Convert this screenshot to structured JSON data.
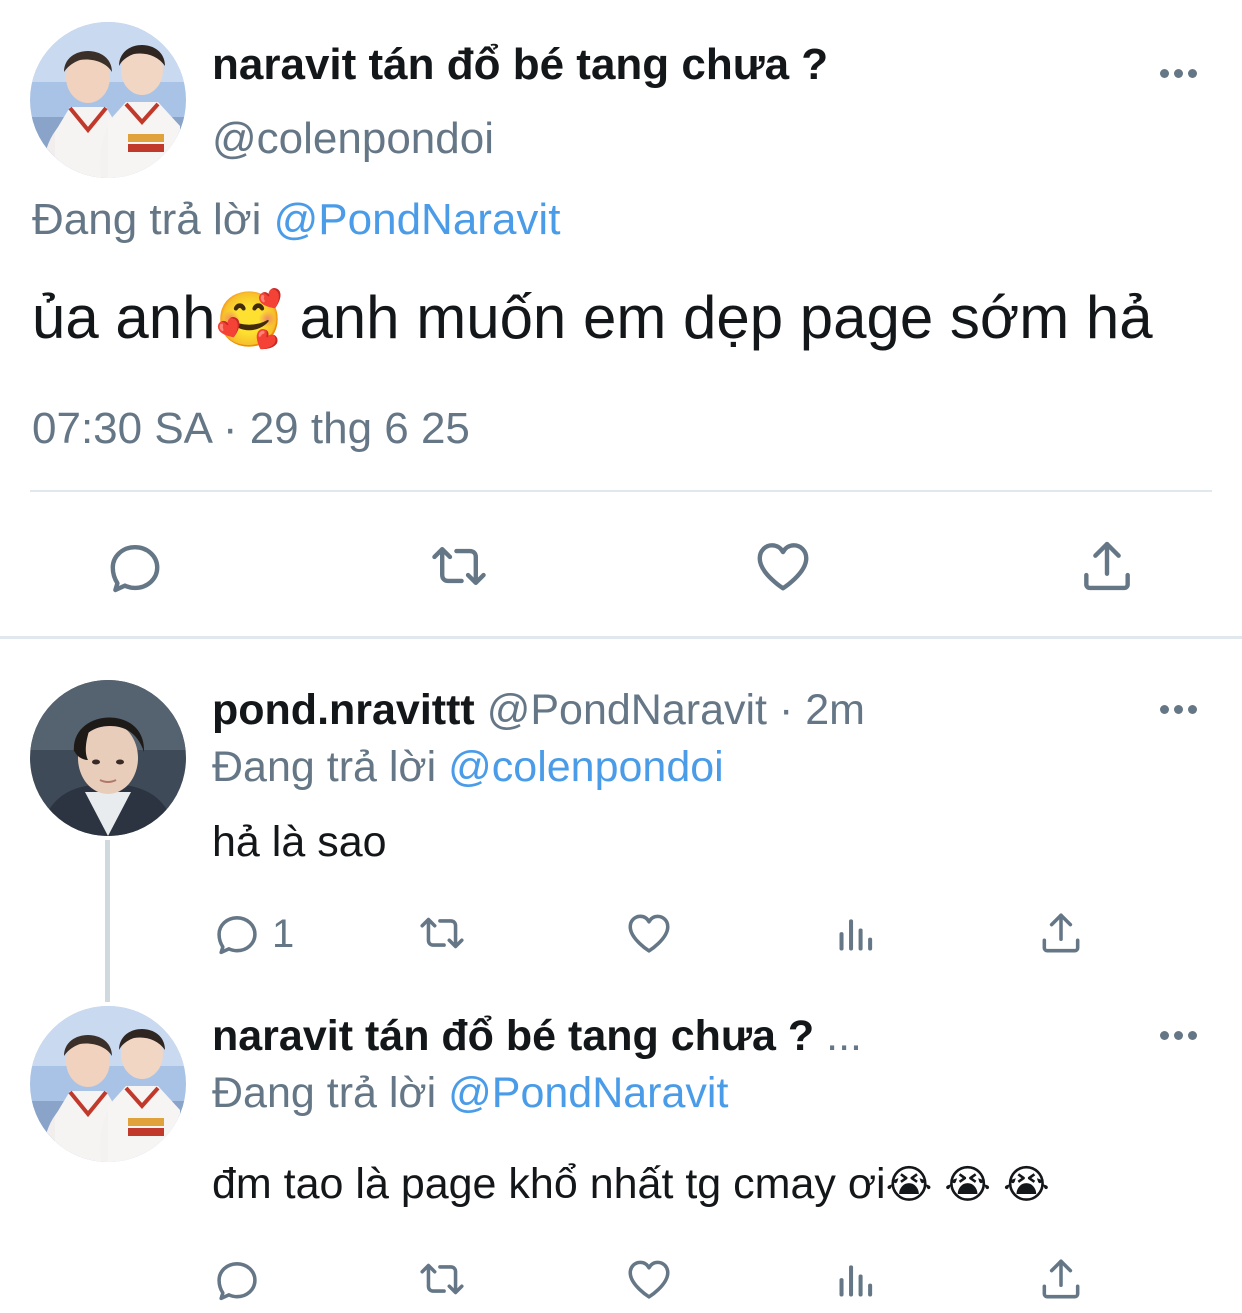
{
  "main_tweet": {
    "display_name": "naravit tán đổ bé tang chưa ?",
    "handle": "@colenpondoi",
    "replying_prefix": "Đang trả lời",
    "replying_to": "@PondNaravit",
    "text": "ủa anh",
    "emoji": "🥰",
    "text_after_emoji": "anh muốn em dẹp page sớm hả",
    "timestamp": "07:30 SA · 29 thg 6 25",
    "actions": [
      "reply-icon",
      "retweet-icon",
      "like-icon",
      "share-icon"
    ]
  },
  "replies": [
    {
      "display_name": "pond.nravittt",
      "handle": "@PondNaravit",
      "separator": "·",
      "time": "2m",
      "replying_prefix": "Đang trả lời",
      "replying_to": "@colenpondoi",
      "text": "hả là sao",
      "reply_count": "1",
      "actions": [
        "reply-icon",
        "retweet-icon",
        "like-icon",
        "analytics-icon",
        "share-icon"
      ]
    },
    {
      "display_name": "naravit tán đổ bé tang chưa ?",
      "ellipsis": "...",
      "replying_prefix": "Đang trả lời",
      "replying_to": "@PondNaravit",
      "text": "đm tao là page khổ nhất tg cmay ơi",
      "emojis": [
        "😭",
        "😭",
        "😭"
      ],
      "actions": [
        "reply-icon",
        "retweet-icon",
        "like-icon",
        "analytics-icon",
        "share-icon"
      ]
    }
  ],
  "colors": {
    "text": "#14171a",
    "secondary": "#657786",
    "link": "#4a9ce8",
    "divider": "#e1e8ed"
  }
}
